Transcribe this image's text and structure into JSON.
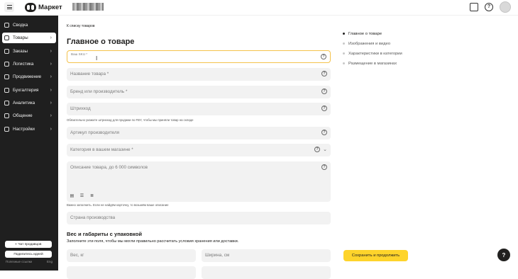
{
  "header": {
    "brand": "Маркет",
    "help_icon": "?"
  },
  "sidebar": {
    "items": [
      {
        "label": "Сводка",
        "icon": "summary-icon"
      },
      {
        "label": "Товары",
        "icon": "box-icon",
        "active": true
      },
      {
        "label": "Заказы",
        "icon": "cart-icon"
      },
      {
        "label": "Логистика",
        "icon": "truck-icon"
      },
      {
        "label": "Продвижение",
        "icon": "promo-icon"
      },
      {
        "label": "Бухгалтерия",
        "icon": "ruble-icon"
      },
      {
        "label": "Аналитика",
        "icon": "chart-icon"
      },
      {
        "label": "Общение",
        "icon": "chat-icon"
      },
      {
        "label": "Настройки",
        "icon": "gear-icon"
      }
    ],
    "chat_button": "Чат продавцов",
    "idea_button": "Поделитесь идеей",
    "footer_left": "Полезные ссылки",
    "footer_right": "Eng"
  },
  "breadcrumb": {
    "back": "К списку товаров"
  },
  "form": {
    "title": "Главное о товаре",
    "sku_label": "Ваш SKU *",
    "name_placeholder": "Название товара *",
    "brand_placeholder": "Бренд или производитель *",
    "barcode_placeholder": "Штрихкод",
    "barcode_hint": "Обязательно укажите штрихкод для продажи по FBY, чтобы мы приняли товар на складе",
    "vendor_code_placeholder": "Артикул производителя",
    "category_placeholder": "Категория в вашем магазине *",
    "description_placeholder": "Описание товара, до 6 000 символов",
    "description_hint": "Важно заполнить. Если не найдём карточку, то возьмём ваше описание",
    "country_placeholder": "Страна производства",
    "dims_title": "Вес и габариты с упаковкой",
    "dims_subtitle": "Заполните эти поля, чтобы мы могли правильно рассчитать условия хранения или доставки.",
    "weight_placeholder": "Вес, кг",
    "width_placeholder": "Ширина, см"
  },
  "anchors": [
    {
      "label": "Главное о товаре",
      "current": true
    },
    {
      "label": "Изображения и видео"
    },
    {
      "label": "Характеристики в категории"
    },
    {
      "label": "Размещение в магазинах"
    }
  ],
  "actions": {
    "save": "Сохранить и продолжить"
  },
  "colors": {
    "accent": "#fed42b",
    "sidebar_bg": "#1f1f1f",
    "focus_border": "#f4c24b",
    "field_bg": "#f2f2f2"
  }
}
